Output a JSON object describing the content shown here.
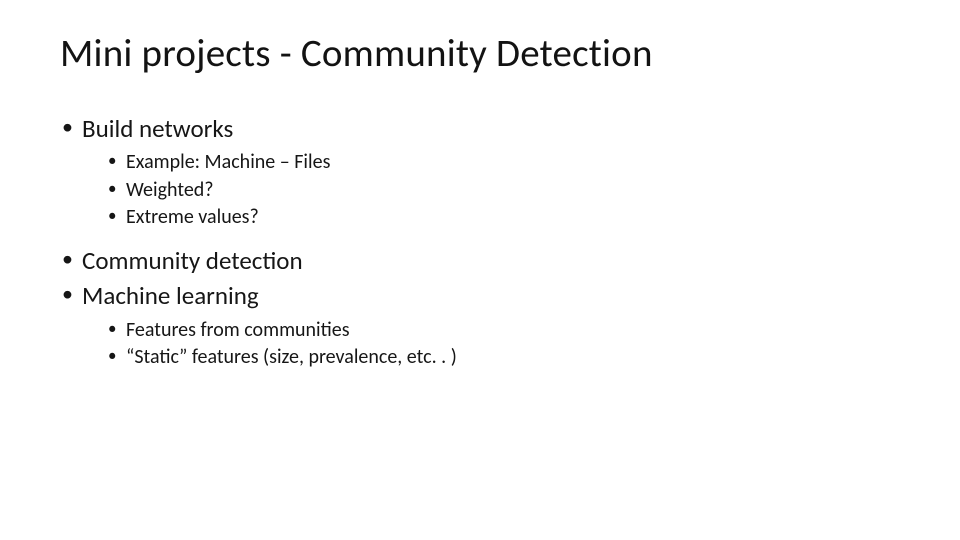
{
  "title": "Mini projects - Community Detection",
  "bullets": {
    "l1_0": "Build networks",
    "l1_0_sub": {
      "s0": "Example: Machine – Files",
      "s1": "Weighted?",
      "s2": "Extreme values?"
    },
    "l1_1": "Community detection",
    "l1_2": "Machine learning",
    "l1_2_sub": {
      "s0": "Features from communities",
      "s1": "“Static” features (size, prevalence, etc. . )"
    }
  }
}
